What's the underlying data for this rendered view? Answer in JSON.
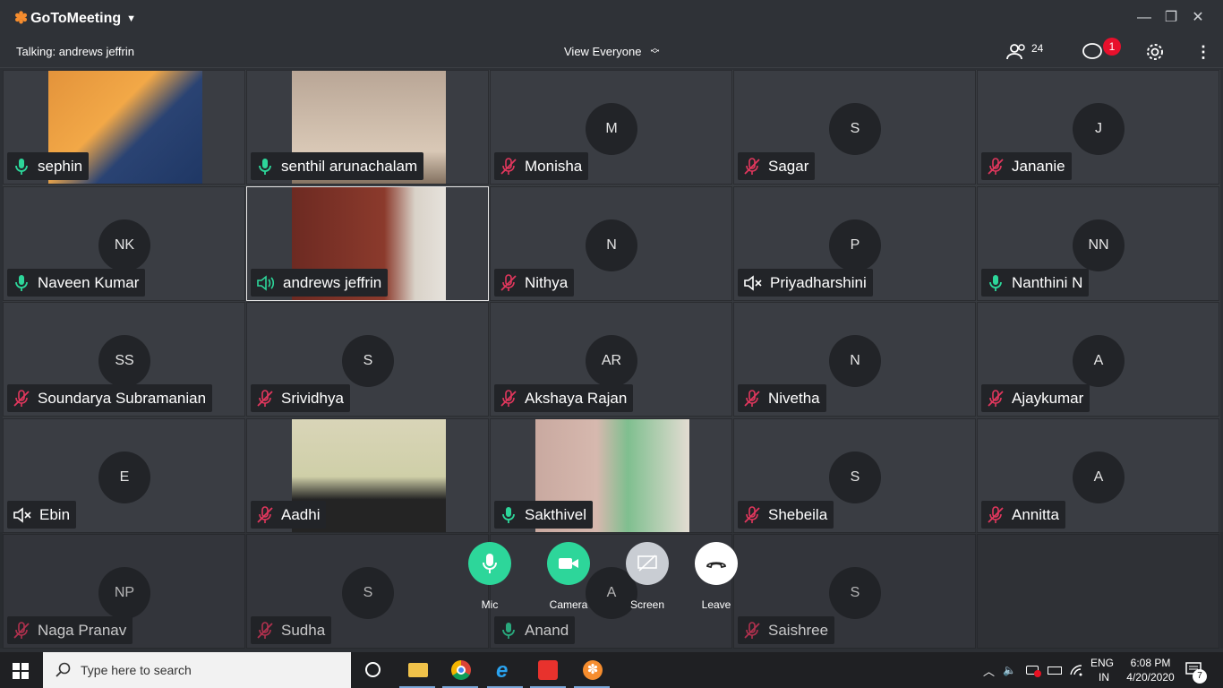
{
  "app": {
    "name": "GoToMeeting"
  },
  "toolbar": {
    "talking": "Talking: andrews jeffrin",
    "view": "View Everyone",
    "participants_count": "24",
    "chat_badge": "1"
  },
  "participants": [
    {
      "name": "sephin",
      "status": "mic-on",
      "video": true
    },
    {
      "name": "senthil arunachalam",
      "status": "mic-on",
      "video": true
    },
    {
      "name": "Monisha",
      "initials": "M",
      "status": "mic-off"
    },
    {
      "name": "Sagar",
      "initials": "S",
      "status": "mic-off"
    },
    {
      "name": "Jananie",
      "initials": "J",
      "status": "mic-off"
    },
    {
      "name": "Naveen Kumar",
      "initials": "NK",
      "status": "mic-on"
    },
    {
      "name": "andrews jeffrin",
      "status": "speaking",
      "video": true
    },
    {
      "name": "Nithya",
      "initials": "N",
      "status": "mic-off"
    },
    {
      "name": "Priyadharshini",
      "initials": "P",
      "status": "speaker-muted"
    },
    {
      "name": "Nanthini N",
      "initials": "NN",
      "status": "mic-on"
    },
    {
      "name": "Soundarya Subramanian",
      "initials": "SS",
      "status": "mic-off"
    },
    {
      "name": "Srividhya",
      "initials": "S",
      "status": "mic-off"
    },
    {
      "name": "Akshaya Rajan",
      "initials": "AR",
      "status": "mic-off"
    },
    {
      "name": "Nivetha",
      "initials": "N",
      "status": "mic-off"
    },
    {
      "name": "Ajaykumar",
      "initials": "A",
      "status": "mic-off"
    },
    {
      "name": "Ebin",
      "initials": "E",
      "status": "speaker-muted"
    },
    {
      "name": "Aadhi",
      "status": "mic-off",
      "video": true
    },
    {
      "name": "Sakthivel",
      "status": "mic-on",
      "video": true
    },
    {
      "name": "Shebeila",
      "initials": "S",
      "status": "mic-off"
    },
    {
      "name": "Annitta",
      "initials": "A",
      "status": "mic-off"
    },
    {
      "name": "Naga Pranav",
      "initials": "NP",
      "status": "mic-off"
    },
    {
      "name": "Sudha",
      "initials": "S",
      "status": "mic-off"
    },
    {
      "name": "Anand",
      "initials": "A",
      "status": "mic-on"
    },
    {
      "name": "Saishree",
      "initials": "S",
      "status": "mic-off"
    }
  ],
  "controls": {
    "mic": "Mic",
    "camera": "Camera",
    "screen": "Screen",
    "leave": "Leave"
  },
  "taskbar": {
    "search_placeholder": "Type here to search",
    "lang1": "ENG",
    "lang2": "IN",
    "time": "6:08 PM",
    "date": "4/20/2020",
    "notif_count": "7"
  },
  "colors": {
    "mic_on": "#2dd69a",
    "mic_off": "#e2375d",
    "accent": "#f68d2e"
  }
}
